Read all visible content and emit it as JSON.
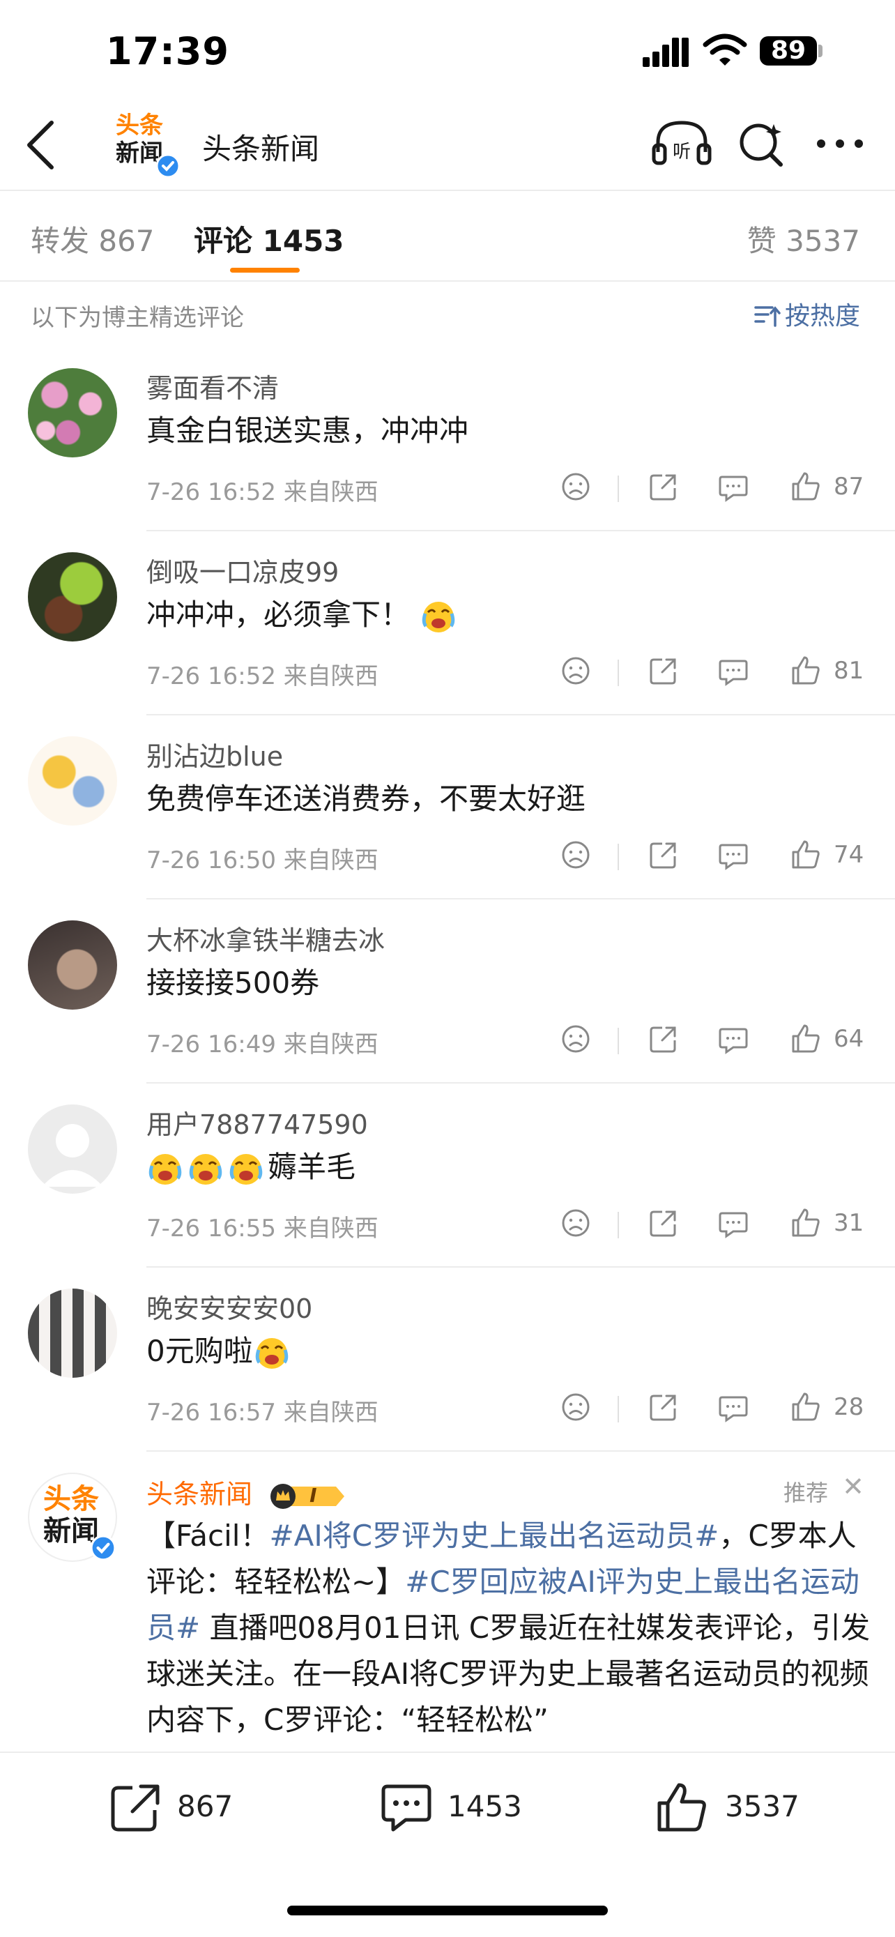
{
  "status": {
    "time": "17:39",
    "battery": "89"
  },
  "header": {
    "title": "头条新闻",
    "logo_text_top": "头条",
    "logo_text_bottom": "新闻"
  },
  "tabs": {
    "repost": "转发 867",
    "comment": "评论 1453",
    "like": "赞 3537"
  },
  "section_note": "以下为博主精选评论",
  "sort_label": "按热度",
  "comments": [
    {
      "user": "雾面看不清",
      "text": "真金白银送实惠，冲冲冲",
      "time": "7-26 16:52",
      "location": "来自陕西",
      "likes": "87"
    },
    {
      "user": "倒吸一口凉皮99",
      "text": "冲冲冲，必须拿下！",
      "time": "7-26 16:52",
      "location": "来自陕西",
      "likes": "81"
    },
    {
      "user": "别沾边blue",
      "text": "免费停车还送消费券，不要太好逛",
      "time": "7-26 16:50",
      "location": "来自陕西",
      "likes": "74"
    },
    {
      "user": "大杯冰拿铁半糖去冰",
      "text": "接接接500券",
      "time": "7-26 16:49",
      "location": "来自陕西",
      "likes": "64"
    },
    {
      "user": "用户7887747590",
      "text": "薅羊毛",
      "time": "7-26 16:55",
      "location": "来自陕西",
      "likes": "31"
    },
    {
      "user": "晚安安安安00",
      "text": "0元购啦",
      "time": "7-26 16:57",
      "location": "来自陕西",
      "likes": "28"
    }
  ],
  "promoted": {
    "user": "头条新闻",
    "badge_level": "I",
    "label": "推荐",
    "body_1": "【Fácil！",
    "tag_1": "#AI将C罗评为史上最出名运动员#",
    "body_2": "，C罗本人评论：轻轻松松~】",
    "tag_2": "#C罗回应被AI评为史上最出名运动员#",
    "body_3": " 直播吧08月01日讯 C罗最近在社媒发表评论，引发球迷关注。在一段AI将C罗评为史上最著名运动员的视频内容下，C罗评论：“轻轻松松”"
  },
  "bottom_bar": {
    "repost": "867",
    "comment": "1453",
    "like": "3537"
  },
  "colors": {
    "accent": "#ff8200",
    "link": "#4c6fa3",
    "verified": "#2d8cf0"
  }
}
